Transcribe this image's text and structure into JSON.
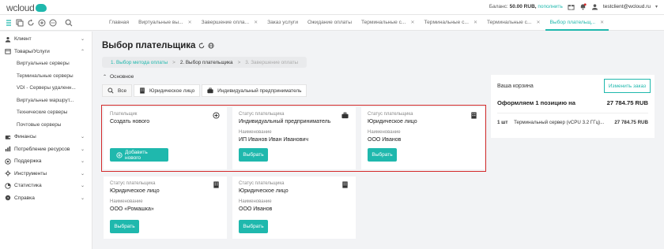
{
  "header": {
    "logo_text": "wcloud",
    "balance_label": "Баланс:",
    "balance_value": "50.00 RUB,",
    "topup_label": "пополнить",
    "user_email": "testclient@wcloud.ru"
  },
  "tabs": [
    {
      "label": "Главная",
      "closable": false
    },
    {
      "label": "Виртуальные вы...",
      "closable": true
    },
    {
      "label": "Завершение опла...",
      "closable": true
    },
    {
      "label": "Заказ услуги",
      "closable": false
    },
    {
      "label": "Ожидание оплаты",
      "closable": false
    },
    {
      "label": "Терминальные с...",
      "closable": true
    },
    {
      "label": "Терминальные с...",
      "closable": true
    },
    {
      "label": "Терминальные с...",
      "closable": true
    },
    {
      "label": "Выбор плательщ...",
      "closable": true,
      "active": true
    }
  ],
  "sidebar": {
    "items": [
      {
        "label": "Клиент",
        "icon": "user-icon"
      },
      {
        "label": "Товары/Услуги",
        "icon": "box-icon"
      },
      {
        "label": "Финансы",
        "icon": "wallet-icon"
      },
      {
        "label": "Потребление ресурсов",
        "icon": "chart-icon"
      },
      {
        "label": "Поддержка",
        "icon": "support-icon"
      },
      {
        "label": "Инструменты",
        "icon": "tools-icon"
      },
      {
        "label": "Статистика",
        "icon": "stats-icon"
      },
      {
        "label": "Справка",
        "icon": "help-icon"
      }
    ],
    "subitems": [
      "Виртуальные серверы",
      "Терминальные серверы",
      "VDI - Серверы удаленн...",
      "Виртуальные маршрут...",
      "Технические серверы",
      "Почтовые серверы"
    ]
  },
  "main": {
    "title": "Выбор плательщика",
    "steps": {
      "step1": "1. Выбор метода оплаты",
      "step2": "2. Выбор плательщика",
      "step3": "3. Завершение оплаты",
      "sep": ">"
    },
    "section_label": "Основное",
    "filters": {
      "all": "Все",
      "legal": "Юридическое лицо",
      "individual": "Индивидуальный предприниматель"
    },
    "cards": {
      "new": {
        "payer_label": "Плательщик",
        "payer_value": "Создать нового",
        "button": "Добавить нового"
      },
      "c2": {
        "status_label": "Статус плательщика",
        "status_value": "Индивидуальный предприниматель",
        "name_label": "Наименование",
        "name_value": "ИП Иванов Иван Иванович",
        "button": "Выбрать"
      },
      "c3": {
        "status_label": "Статус плательщика",
        "status_value": "Юридическое лицо",
        "name_label": "Наименование",
        "name_value": "ООО Иванов",
        "button": "Выбрать"
      },
      "c4": {
        "status_label": "Статус плательщика",
        "status_value": "Юридическое лицо",
        "name_label": "Наименование",
        "name_value": "ООО «Ромашка»",
        "button": "Выбрать"
      },
      "c5": {
        "status_label": "Статус плательщика",
        "status_value": "Юридическое лицо",
        "name_label": "Наименование",
        "name_value": "ООО Иванов",
        "button": "Выбрать"
      }
    }
  },
  "cart": {
    "title": "Ваша корзина",
    "change_button": "Изменить заказ",
    "summary_label": "Оформляем 1 позицию на",
    "summary_total": "27 784.75 RUB",
    "item_qty": "1 шт",
    "item_name": "Терминальный сервер (vCPU 3.2 ГГц)...",
    "item_price": "27 784.75 RUB"
  },
  "colors": {
    "accent": "#1fb8ad",
    "highlight_border": "#d42a2a"
  }
}
